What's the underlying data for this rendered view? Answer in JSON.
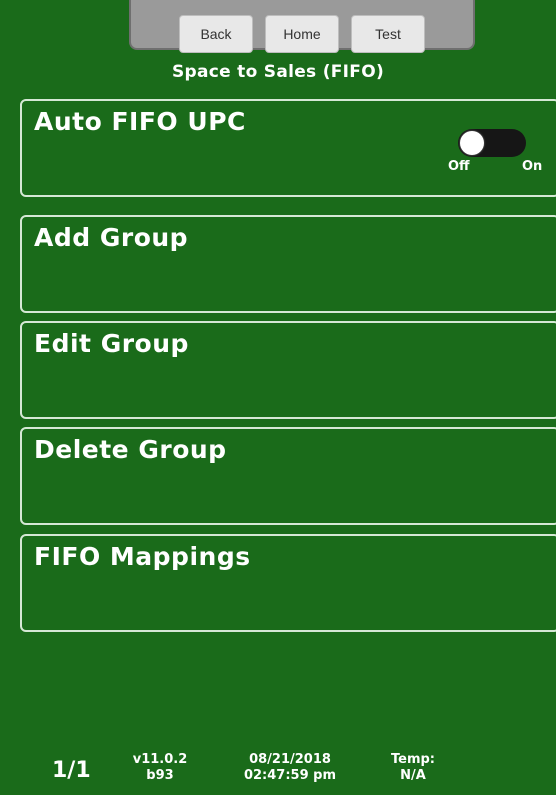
{
  "header": {
    "buttons": {
      "back": "Back",
      "home": "Home",
      "test": "Test"
    },
    "title": "Space to Sales (FIFO)"
  },
  "menu": {
    "items": [
      {
        "label": "Auto FIFO UPC"
      },
      {
        "label": "Add Group"
      },
      {
        "label": "Edit Group"
      },
      {
        "label": "Delete Group"
      },
      {
        "label": "FIFO Mappings"
      }
    ],
    "toggle": {
      "off_label": "Off",
      "on_label": "On",
      "state": "Off"
    }
  },
  "footer": {
    "page": "1/1",
    "version": "v11.0.2",
    "build": "b93",
    "date": "08/21/2018",
    "time": "02:47:59 pm",
    "temp_label": "Temp:",
    "temp_value": "N/A"
  },
  "colors": {
    "background": "#1a6b1a",
    "border": "#d5e8d5",
    "topbar": "#9a9a9a",
    "button": "#e8e8e8",
    "text": "#ffffff"
  }
}
